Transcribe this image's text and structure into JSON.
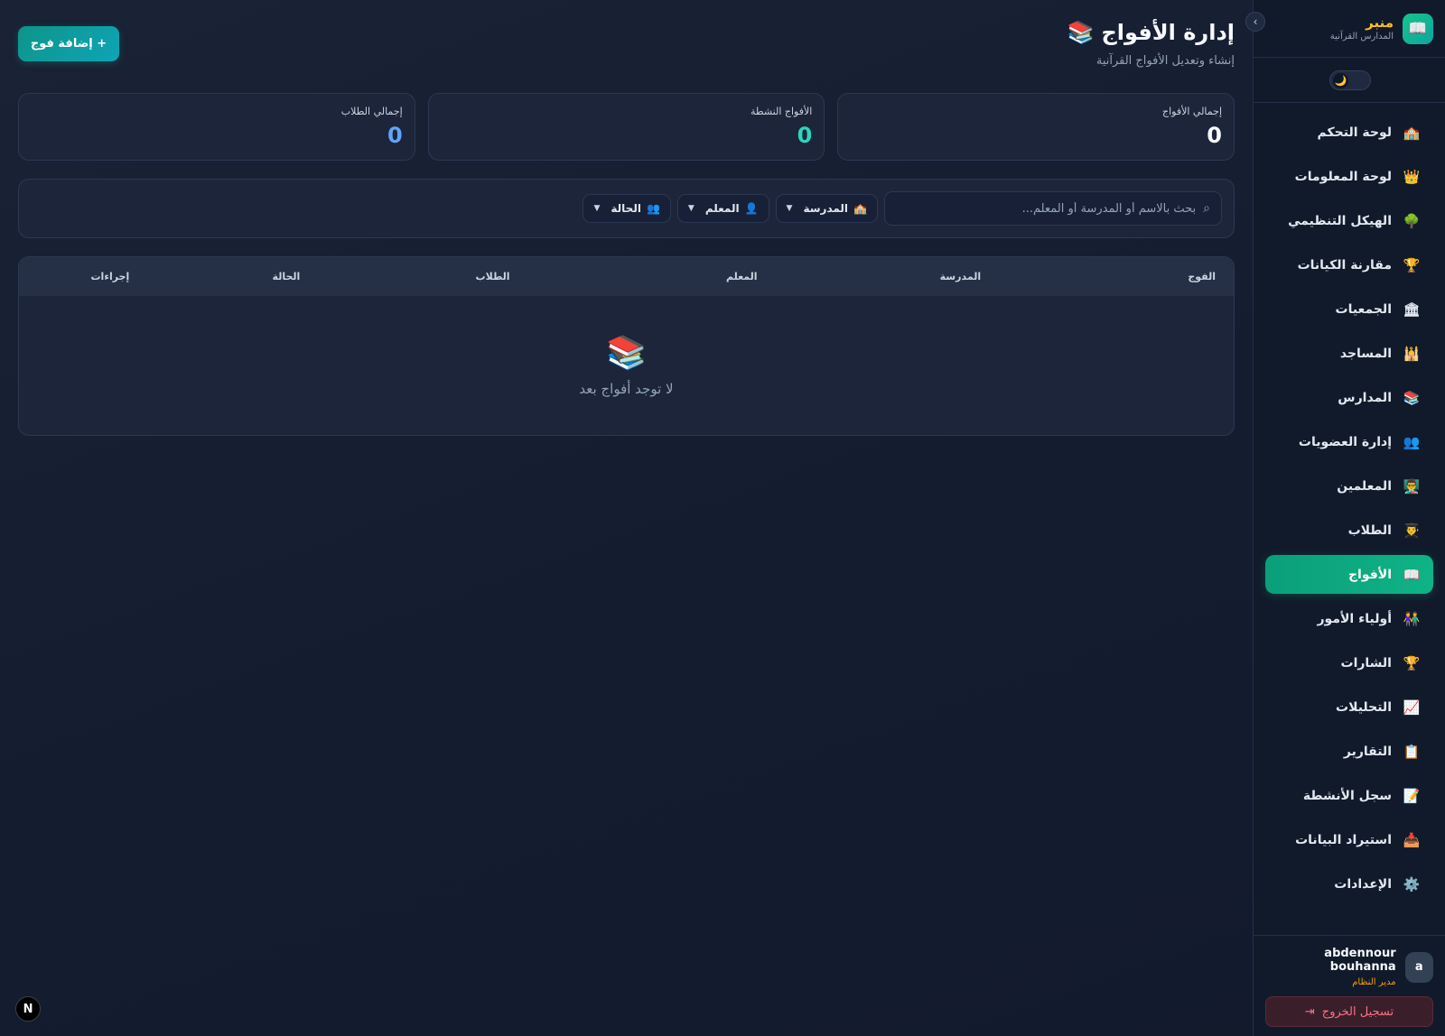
{
  "brand": {
    "name": "منبر",
    "subtitle": "المدارس القرآنية",
    "logo_icon": "📖"
  },
  "sidebar": {
    "collapse_icon": "chevron-left-icon",
    "theme_icon": "🌙",
    "items": [
      {
        "label": "لوحة التحكم",
        "icon": "🏫"
      },
      {
        "label": "لوحة المعلومات",
        "icon": "👑"
      },
      {
        "label": "الهيكل التنظيمي",
        "icon": "🌳"
      },
      {
        "label": "مقارنة الكيانات",
        "icon": "🏆"
      },
      {
        "label": "الجمعيات",
        "icon": "🏛"
      },
      {
        "label": "المساجد",
        "icon": "🕌"
      },
      {
        "label": "المدارس",
        "icon": "📚"
      },
      {
        "label": "إدارة العضويات",
        "icon": "👥"
      },
      {
        "label": "المعلمين",
        "icon": "👨‍🏫"
      },
      {
        "label": "الطلاب",
        "icon": "👨‍🎓"
      },
      {
        "label": "الأفواج",
        "icon": "📖"
      },
      {
        "label": "أولياء الأمور",
        "icon": "👫"
      },
      {
        "label": "الشارات",
        "icon": "🏆"
      },
      {
        "label": "التحليلات",
        "icon": "📈"
      },
      {
        "label": "التقارير",
        "icon": "📋"
      },
      {
        "label": "سجل الأنشطة",
        "icon": "📝"
      },
      {
        "label": "استيراد البيانات",
        "icon": "📥"
      },
      {
        "label": "الإعدادات",
        "icon": "⚙️"
      }
    ],
    "active_index": 10
  },
  "user": {
    "avatar_letter": "a",
    "name": "abdennour bouhanna",
    "role": "مدير النظام",
    "logout_label": "تسجيل الخروج"
  },
  "header": {
    "title": "إدارة الأفواج",
    "title_icon": "📚",
    "subtitle": "إنشاء وتعديل الأفواج القرآنية",
    "add_button": "+ إضافة فوج"
  },
  "stats": [
    {
      "label": "إجمالي الأفواج",
      "value": "0",
      "color": "#f8fafc"
    },
    {
      "label": "الأفواج النشطة",
      "value": "0",
      "color": "#2dd4bf"
    },
    {
      "label": "إجمالي الطلاب",
      "value": "0",
      "color": "#60a5fa"
    }
  ],
  "filters": {
    "search_placeholder": "بحث بالاسم أو المدرسة أو المعلم...",
    "search_value": "",
    "school": "المدرسة",
    "teacher": "المعلم",
    "status": "الحالة"
  },
  "table": {
    "columns": [
      "الفوج",
      "المدرسة",
      "المعلم",
      "الطلاب",
      "الحالة",
      "إجراءات"
    ],
    "empty_icon": "📚",
    "empty_text": "لا توجد أفواج بعد"
  },
  "devtools_badge": "N"
}
